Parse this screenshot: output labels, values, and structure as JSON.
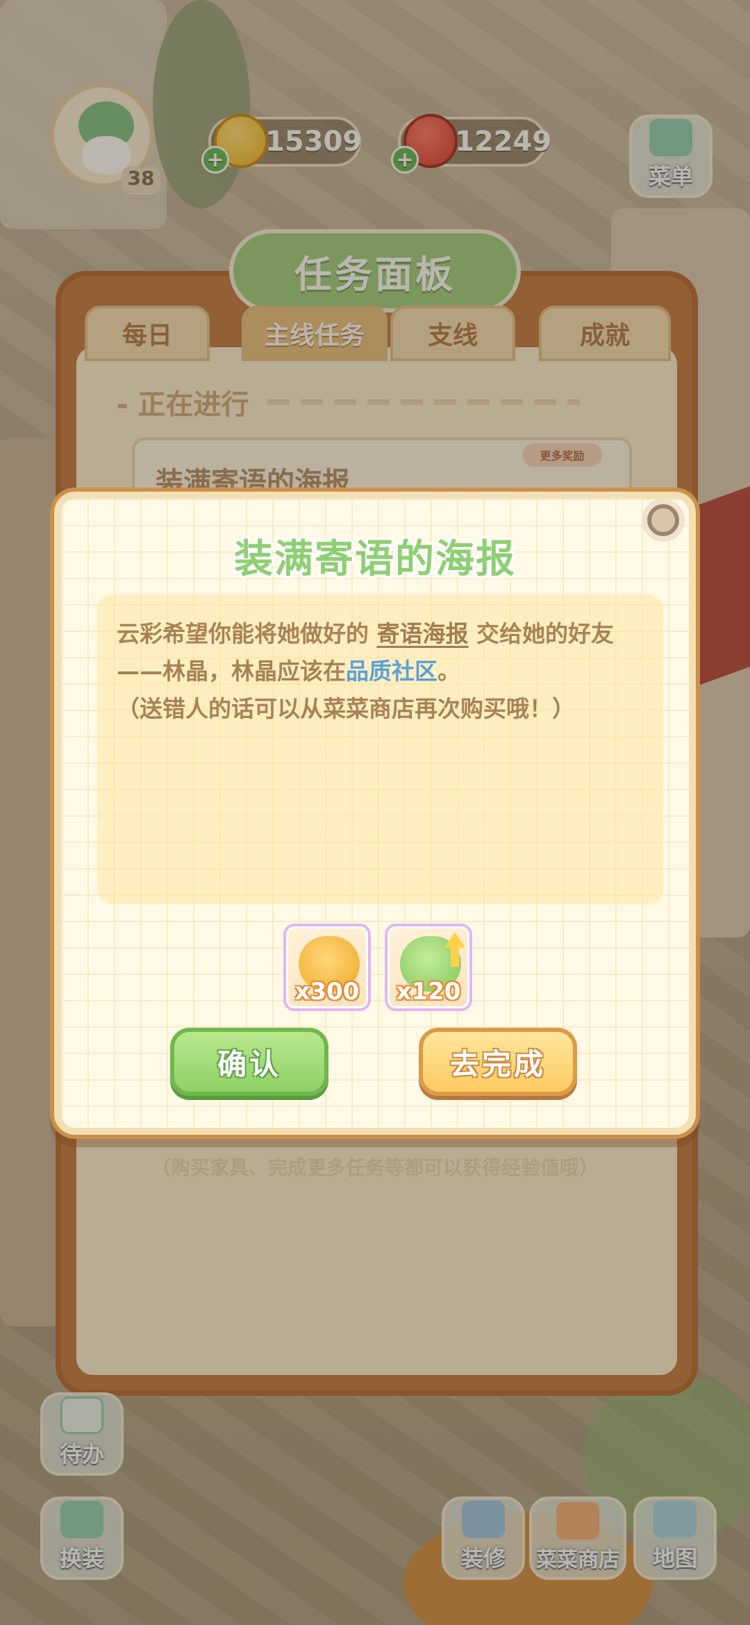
{
  "hud": {
    "level": "38",
    "coins": "15309",
    "tomatoes": "12249",
    "menu_label": "菜单"
  },
  "side_buttons": {
    "todo": "待办",
    "outfit": "换装",
    "decorate": "装修",
    "shop": "菜菜商店",
    "map": "地图"
  },
  "task_panel": {
    "title": "任务面板",
    "tabs": [
      "每日",
      "主线任务",
      "支线",
      "成就"
    ],
    "active_tab": "主线任务",
    "in_progress_label": "- 正在进行",
    "task_name": "装满寄语的海报",
    "more_rewards": "更多奖励",
    "footer_hint": "（购买家具、完成更多任务等都可以获得经验值哦）"
  },
  "dialog": {
    "title": "装满寄语的海报",
    "desc_part1": "云彩希望你能将她做好的 ",
    "desc_item": "寄语海报",
    "desc_part2": " 交给她的好友——林晶，林晶应该在",
    "desc_location": "品质社区",
    "desc_part3": "。",
    "desc_line3": "（送错人的话可以从菜菜商店再次购买哦！）",
    "rewards": [
      {
        "icon": "gold-coin-pile-icon",
        "qty": "x300"
      },
      {
        "icon": "leaf-exp-up-icon",
        "qty": "x120"
      }
    ],
    "confirm_label": "确认",
    "go_label": "去完成"
  },
  "colors": {
    "title_green": "#8fcf74",
    "confirm_green": "#8fd164",
    "go_orange": "#ffcb63",
    "location_blue": "#5aa0d8"
  }
}
